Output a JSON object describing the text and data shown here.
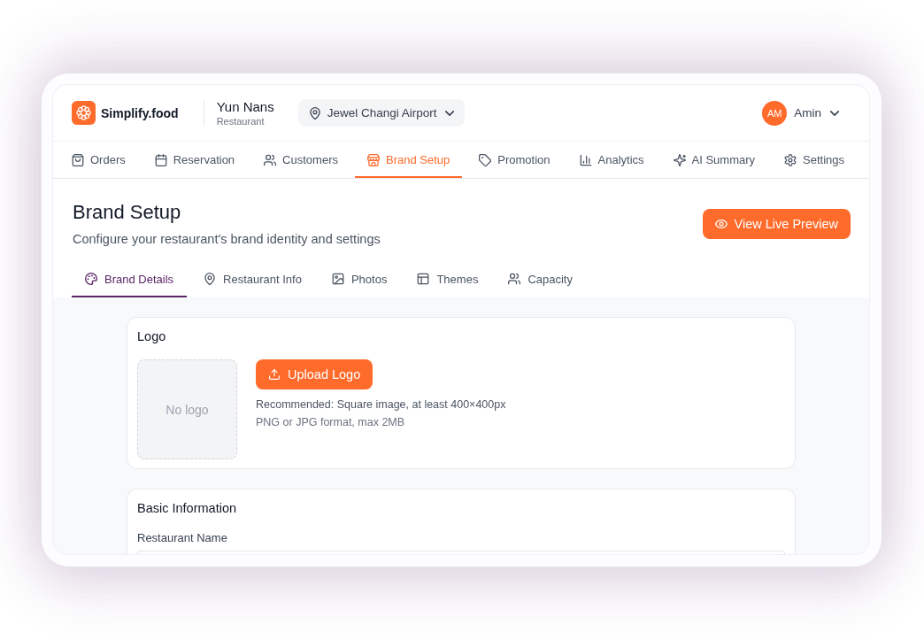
{
  "header": {
    "logo_text": "Simplify.food",
    "restaurant_name": "Yun Nans",
    "restaurant_type": "Restaurant",
    "location": "Jewel Changi Airport",
    "user_initials": "AM",
    "user_name": "Amin"
  },
  "nav": [
    {
      "label": "Orders",
      "selected": false
    },
    {
      "label": "Reservation",
      "selected": false
    },
    {
      "label": "Customers",
      "selected": false
    },
    {
      "label": "Brand Setup",
      "selected": true
    },
    {
      "label": "Promotion",
      "selected": false
    },
    {
      "label": "Analytics",
      "selected": false
    },
    {
      "label": "AI Summary",
      "selected": false
    },
    {
      "label": "Settings",
      "selected": false
    }
  ],
  "page": {
    "title": "Brand Setup",
    "subtitle": "Configure your restaurant's brand identity and settings",
    "action": "View Live Preview"
  },
  "tabs": [
    {
      "label": "Brand Details",
      "selected": true
    },
    {
      "label": "Restaurant Info",
      "selected": false
    },
    {
      "label": "Photos",
      "selected": false
    },
    {
      "label": "Themes",
      "selected": false
    },
    {
      "label": "Capacity",
      "selected": false
    }
  ],
  "logo_card": {
    "title": "Logo",
    "empty_text": "No logo",
    "button": "Upload Logo",
    "hints": [
      "Recommended: Square image, at least 400×400px",
      "PNG or JPG format, max 2MB"
    ]
  },
  "basic_info_card": {
    "title": "Basic Information",
    "fields": [
      {
        "label": "Restaurant Name"
      }
    ]
  }
}
